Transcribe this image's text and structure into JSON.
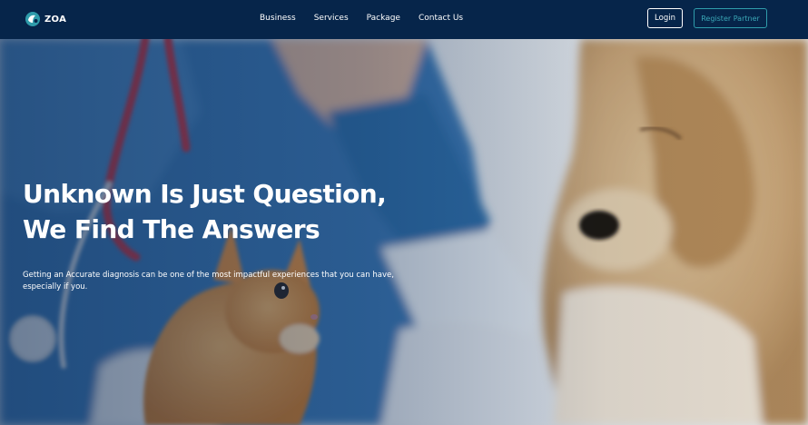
{
  "brand": {
    "name": "ZOA"
  },
  "nav": {
    "links": [
      "Business",
      "Services",
      "Package",
      "Contact Us"
    ],
    "login_label": "Login",
    "register_label": "Register Partner"
  },
  "hero": {
    "headline_line1": "Unknown Is Just Question,",
    "headline_line2": "We Find The Answers",
    "subtext_line1": "Getting an Accurate diagnosis can be one of the most impactful experiences that  you can have,",
    "subtext_line2": "especially if you."
  },
  "colors": {
    "navbar_bg": "#06254a",
    "accent": "#2f9cab",
    "text": "#ffffff"
  },
  "icons": {
    "logo": "paw-drop-logo-icon"
  }
}
